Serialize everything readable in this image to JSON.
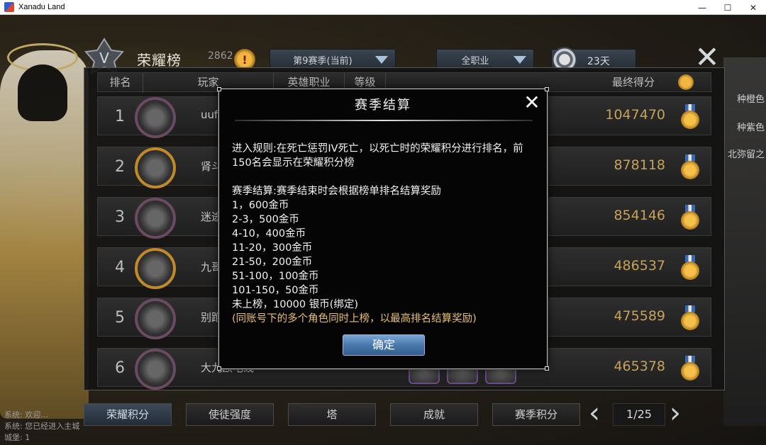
{
  "window": {
    "title": "Xanadu Land",
    "minimize_label": "—",
    "maximize_label": "☐",
    "close_label": "✕"
  },
  "header": {
    "title": "荣耀榜",
    "score": "2862",
    "season_dropdown": "第9赛季(当前)",
    "class_dropdown": "全职业",
    "days_left": "23天",
    "close_label": "✕"
  },
  "table": {
    "columns": [
      "排名",
      "玩家",
      "英雄职业",
      "等级",
      "最终得分"
    ],
    "rows": [
      {
        "rank": "1",
        "player": "uuf",
        "score": "1047470"
      },
      {
        "rank": "2",
        "player": "肾斗",
        "score": "878118"
      },
      {
        "rank": "3",
        "player": "迷途",
        "score": "854146"
      },
      {
        "rank": "4",
        "player": "九哥",
        "score": "486537"
      },
      {
        "rank": "5",
        "player": "别跑",
        "score": "475589"
      },
      {
        "rank": "6",
        "player": "大九欧电线",
        "score": "465378"
      }
    ]
  },
  "tabs": [
    "荣耀积分",
    "使徒强度",
    "塔",
    "成就",
    "赛季积分"
  ],
  "pager": {
    "prev": "‹",
    "page": "1/25",
    "next": "›"
  },
  "side_text": {
    "right": [
      "种橙色",
      "种紫色",
      "北弥留之"
    ],
    "bottom_left": [
      "系统: 欢迎...",
      "系统: 您已经进入主城",
      "城堡: 1"
    ]
  },
  "modal": {
    "title": "赛季结算",
    "close_label": "✕",
    "rules": "进入规则:在死亡惩罚IV死亡，以死亡时的荣耀积分进行排名，前150名会显示在荣耀积分榜",
    "settlement_heading": "赛季结算:赛季结束时会根据榜单排名结算奖励",
    "rewards": [
      "1，600金币",
      "2-3，500金币",
      "4-10，400金币",
      "11-20，300金币",
      "21-50，200金币",
      "51-100，100金币",
      "101-150，50金币",
      "未上榜，10000 银币(绑定)"
    ],
    "note": "(同账号下的多个角色同时上榜，以最高排名结算奖励)",
    "confirm_label": "确定"
  },
  "colors": {
    "score_gold": "#c6a25a",
    "note_yellow": "#e8c069",
    "confirm_blue": "#4a78ad"
  }
}
